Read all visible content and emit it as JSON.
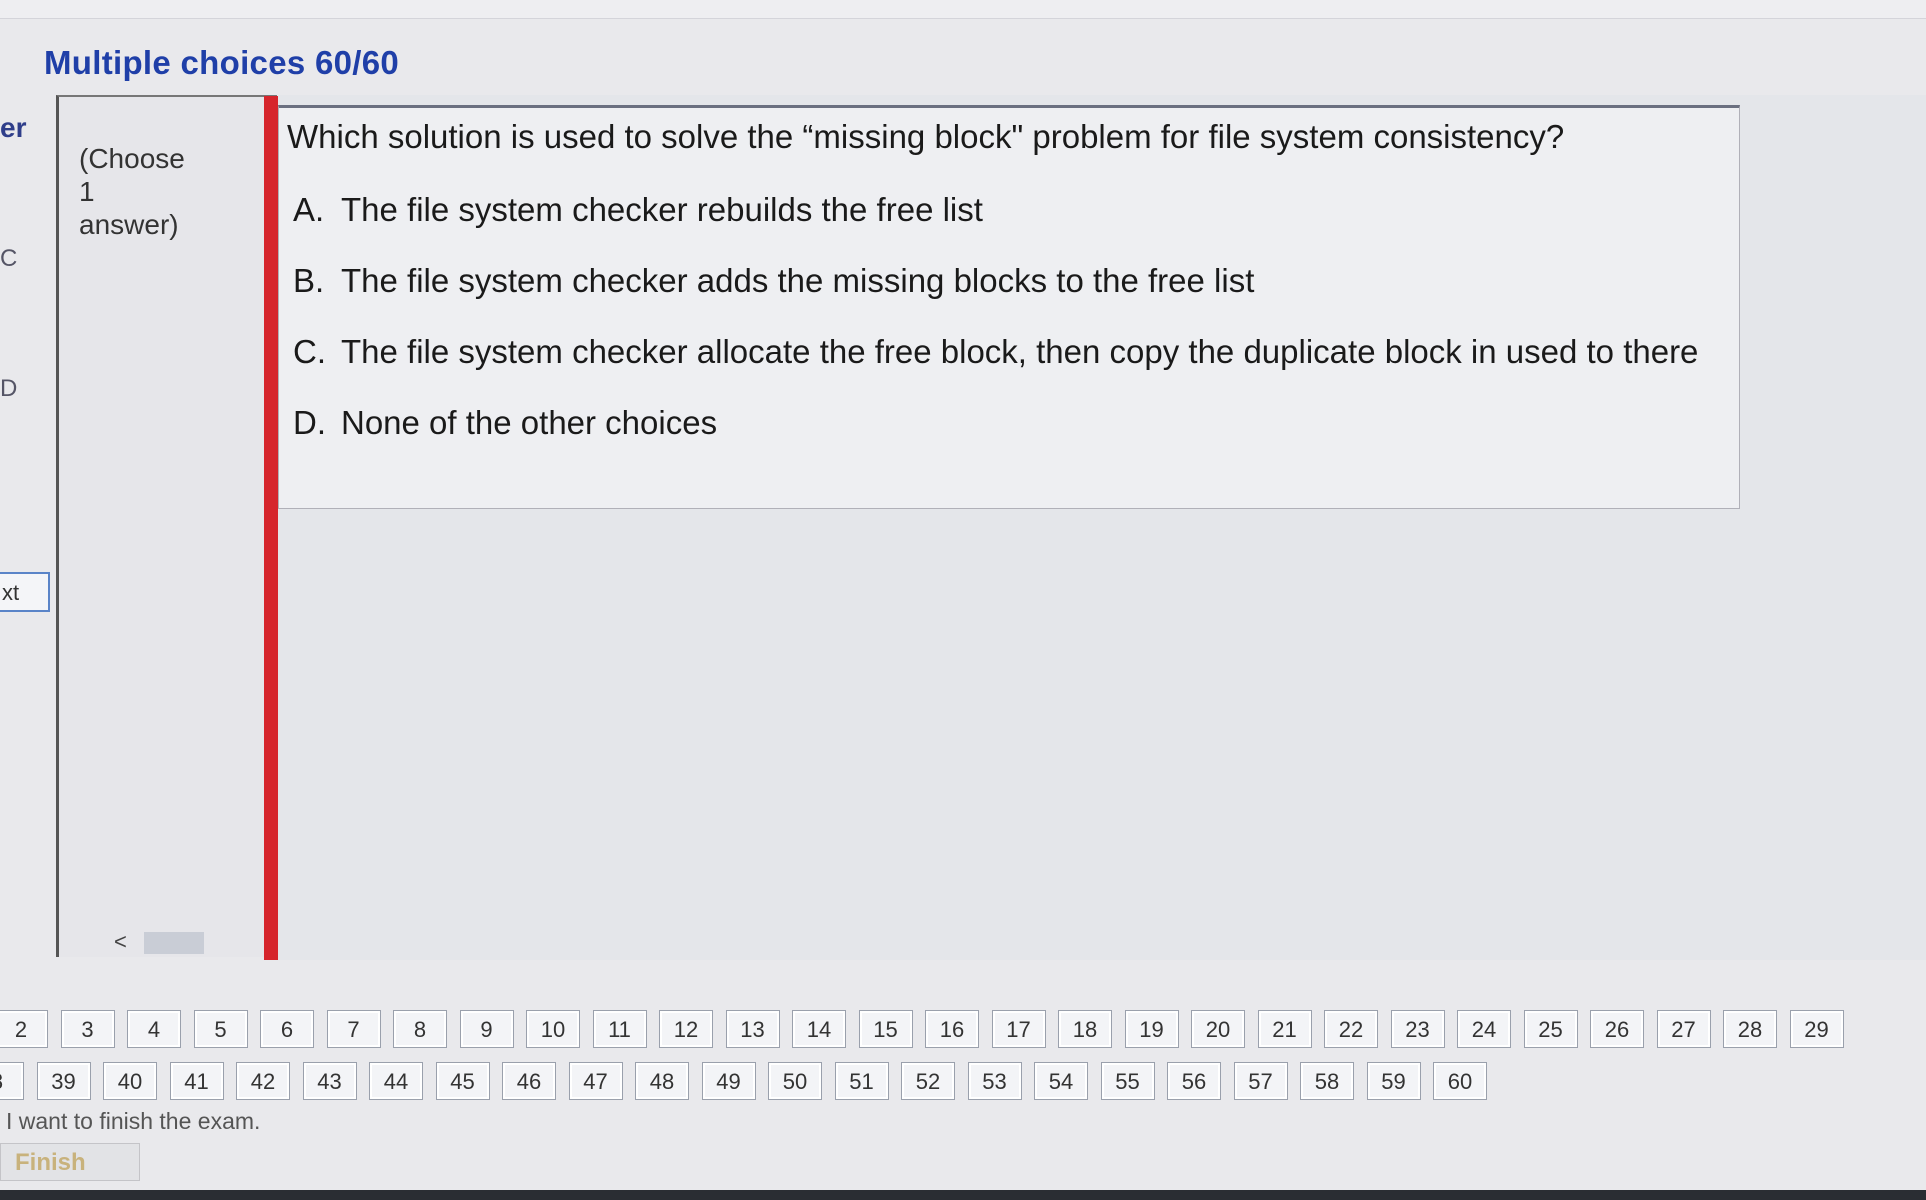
{
  "header": {
    "title": "Multiple choices 60/60"
  },
  "left_edge": {
    "fragment1": "er",
    "fragment2": "C",
    "fragment3": "D",
    "next_label": "xt"
  },
  "side_panel": {
    "choose_line1": "(Choose",
    "choose_line2": "1",
    "choose_line3": "answer)",
    "scroll_left": "<",
    "scroll_right": ">"
  },
  "question": {
    "text": "Which solution is used to solve the “missing block\" problem for file system consistency?",
    "answers": [
      {
        "letter": "A.",
        "text": "The file system checker rebuilds the free list"
      },
      {
        "letter": "B.",
        "text": "The file system checker adds the missing blocks to the free list"
      },
      {
        "letter": "C.",
        "text": "The file system checker allocate the free block, then copy the duplicate block in used to there"
      },
      {
        "letter": "D.",
        "text": "None of  the other choices"
      }
    ]
  },
  "navigation": {
    "row1": [
      "2",
      "3",
      "4",
      "5",
      "6",
      "7",
      "8",
      "9",
      "10",
      "11",
      "12",
      "13",
      "14",
      "15",
      "16",
      "17",
      "18",
      "19",
      "20",
      "21",
      "22",
      "23",
      "24",
      "25",
      "26",
      "27",
      "28",
      "29"
    ],
    "row2": [
      "8",
      "39",
      "40",
      "41",
      "42",
      "43",
      "44",
      "45",
      "46",
      "47",
      "48",
      "49",
      "50",
      "51",
      "52",
      "53",
      "54",
      "55",
      "56",
      "57",
      "58",
      "59",
      "60"
    ]
  },
  "footer": {
    "finish_prompt": "I want to finish the exam.",
    "finish_label": "Finish"
  }
}
